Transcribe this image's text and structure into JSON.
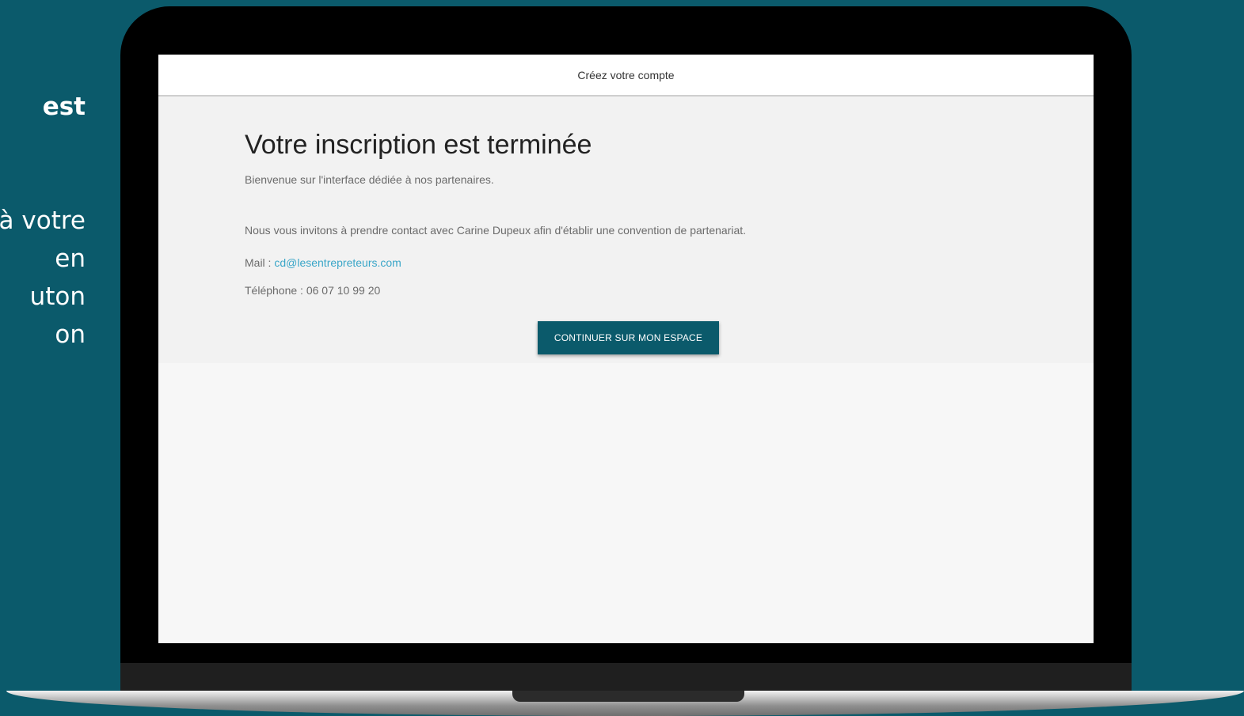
{
  "side_text": {
    "lines": [
      {
        "text": "est",
        "bold": true
      },
      {
        "text": "à votre",
        "bold": false
      },
      {
        "text": "en",
        "bold": false
      },
      {
        "text": "uton",
        "bold": false
      },
      {
        "text": "on",
        "bold": false
      }
    ]
  },
  "header": {
    "title": "Créez votre compte"
  },
  "main": {
    "title": "Votre inscription est terminée",
    "subtitle": "Bienvenue sur l'interface dédiée à nos partenaires.",
    "invite": "Nous vous invitons à prendre contact avec Carine Dupeux afin d'établir une convention de partenariat.",
    "mail_label": "Mail : ",
    "mail_value": "cd@lesentrepreteurs.com",
    "phone_label": "Téléphone : ",
    "phone_value": "06 07 10 99 20",
    "cta_label": "CONTINUER SUR MON ESPACE"
  },
  "colors": {
    "background": "#0b5a6b",
    "button": "#0b5a6b",
    "link": "#3aa6c8"
  }
}
